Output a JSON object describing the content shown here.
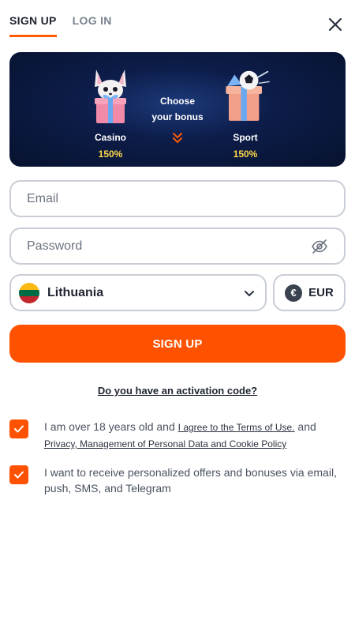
{
  "tabs": {
    "signup": "SIGN UP",
    "login": "LOG IN"
  },
  "bonus": {
    "choose_line1": "Choose",
    "choose_line2": "your bonus",
    "casino": {
      "name": "Casino",
      "percent": "150%"
    },
    "sport": {
      "name": "Sport",
      "percent": "150%"
    }
  },
  "form": {
    "email_placeholder": "Email",
    "password_placeholder": "Password",
    "country": "Lithuania",
    "currency": "EUR",
    "currency_symbol": "€",
    "submit": "SIGN UP"
  },
  "activation_link": "Do you have an activation code?",
  "terms": {
    "prefix": "I am over 18 years old and",
    "link1": "I agree to the Terms of Use.",
    "middle": "and",
    "link2": "Privacy, Management of Personal Data and Cookie Policy",
    "checked": true
  },
  "offers": {
    "text": "I want to receive personalized offers and bonuses via email, push, SMS, and Telegram",
    "checked": true
  },
  "colors": {
    "accent": "#ff5200",
    "banner": "#0d1d4a",
    "bonus_percent": "#ffd84a"
  }
}
